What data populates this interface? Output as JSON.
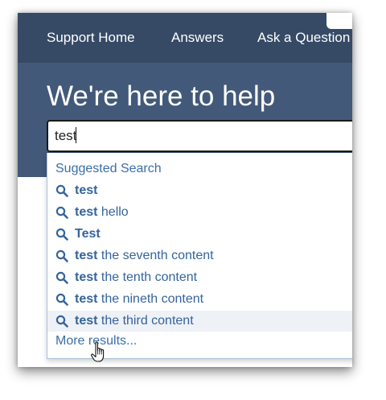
{
  "nav": {
    "items": [
      "Support Home",
      "Answers",
      "Ask a Question"
    ]
  },
  "hero": {
    "title": "We're here to help"
  },
  "search": {
    "value": "test"
  },
  "dropdown": {
    "header": "Suggested Search",
    "suggestions": [
      {
        "bold": "test",
        "rest": ""
      },
      {
        "bold": "test",
        "rest": " hello"
      },
      {
        "bold": "Test",
        "rest": ""
      },
      {
        "bold": "test",
        "rest": " the seventh content"
      },
      {
        "bold": "test",
        "rest": " the tenth content"
      },
      {
        "bold": "test",
        "rest": " the nineth content"
      },
      {
        "bold": "test",
        "rest": " the third content"
      }
    ],
    "highlighted_index": 6,
    "more_label": "More results..."
  },
  "icons": {
    "suggestion": "search-icon",
    "pointer": "hand-pointer-icon"
  },
  "colors": {
    "nav_bg": "#364a66",
    "hero_bg": "#43597a",
    "link": "#34649c",
    "highlight_bg": "#eef1f6"
  }
}
